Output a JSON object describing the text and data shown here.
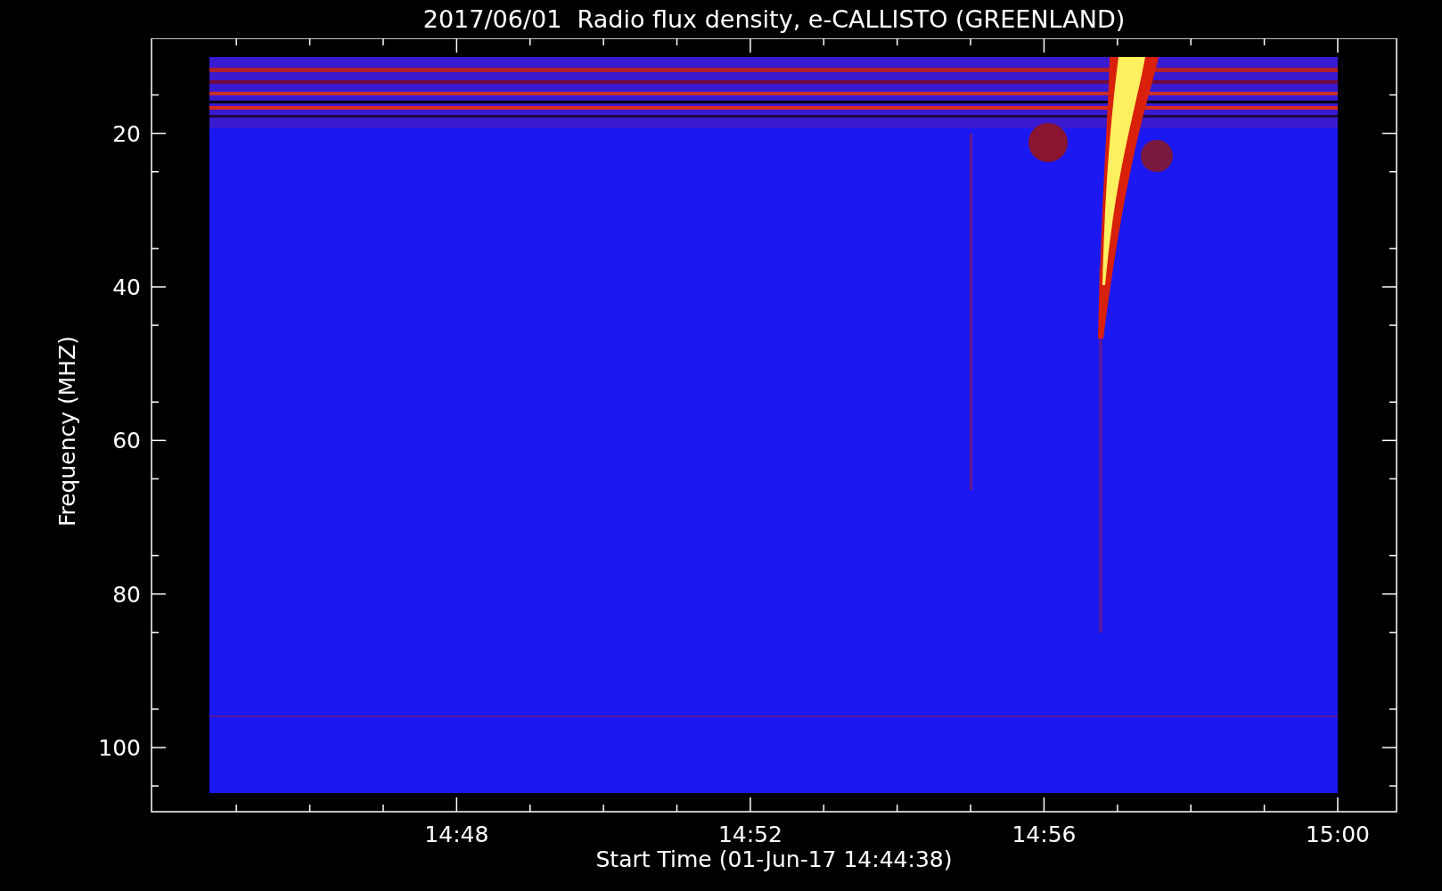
{
  "title": "2017/06/01  Radio flux density, e-CALLISTO (GREENLAND)",
  "y_axis": {
    "label": "Frequency (MHZ)",
    "ticks": [
      "20",
      "40",
      "60",
      "80",
      "100"
    ]
  },
  "x_axis": {
    "label": "Start Time (01-Jun-17 14:44:38)",
    "ticks": [
      "14:48",
      "14:52",
      "14:56",
      "15:00"
    ]
  }
}
